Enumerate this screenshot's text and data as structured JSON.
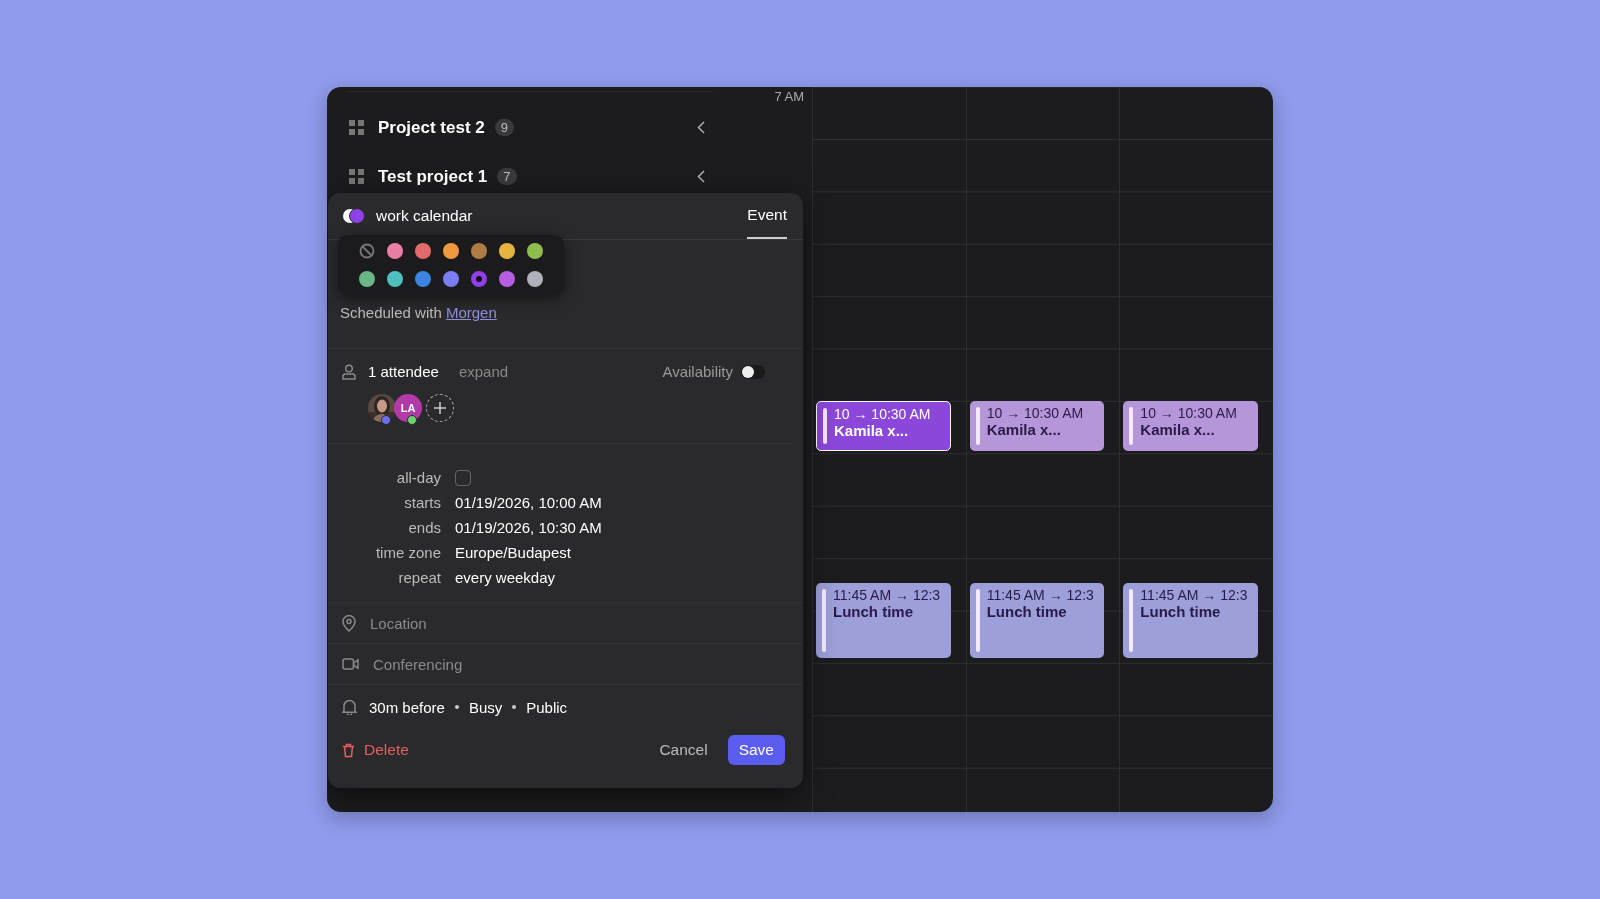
{
  "sidebar": {
    "projects": [
      {
        "name": "Project test 2",
        "count": "9"
      },
      {
        "name": "Test project 1",
        "count": "7"
      }
    ]
  },
  "calendar": {
    "hour_labels": [
      "7 AM"
    ],
    "days": [
      {
        "events": [
          {
            "kind": "meeting",
            "time": "10 → 10:30 AM",
            "title": "Kamila x...",
            "selected": true
          },
          {
            "kind": "lunch",
            "time": "11:45 AM → 12:3",
            "title": "Lunch time",
            "selected": false
          }
        ]
      },
      {
        "events": [
          {
            "kind": "meeting",
            "time": "10 → 10:30 AM",
            "title": "Kamila x...",
            "selected": false
          },
          {
            "kind": "lunch",
            "time": "11:45 AM → 12:3",
            "title": "Lunch time",
            "selected": false
          }
        ]
      },
      {
        "events": [
          {
            "kind": "meeting",
            "time": "10 → 10:30 AM",
            "title": "Kamila x...",
            "selected": false
          },
          {
            "kind": "lunch",
            "time": "11:45 AM → 12:3",
            "title": "Lunch time",
            "selected": false
          }
        ]
      }
    ]
  },
  "event_popup": {
    "calendar_name": "work calendar",
    "tabs": [
      {
        "label": "Event",
        "selected": true
      }
    ],
    "color_picker": {
      "swatches": [
        {
          "kind": "none",
          "selected": false
        },
        {
          "kind": "color",
          "color": "#e97fa6",
          "selected": false
        },
        {
          "kind": "color",
          "color": "#e26a6a",
          "selected": false
        },
        {
          "kind": "color",
          "color": "#ef9a3e",
          "selected": false
        },
        {
          "kind": "color",
          "color": "#b07a45",
          "selected": false
        },
        {
          "kind": "color",
          "color": "#e6b53f",
          "selected": false
        },
        {
          "kind": "color",
          "color": "#8fbc4e",
          "selected": false
        },
        {
          "kind": "color",
          "color": "#6cb587",
          "selected": false
        },
        {
          "kind": "color",
          "color": "#4fc0c0",
          "selected": false
        },
        {
          "kind": "color",
          "color": "#3d84e0",
          "selected": false
        },
        {
          "kind": "color",
          "color": "#7b7ef0",
          "selected": false
        },
        {
          "kind": "color",
          "color": "#9040e8",
          "selected": true
        },
        {
          "kind": "color",
          "color": "#b45fe0",
          "selected": false
        },
        {
          "kind": "color",
          "color": "#b0b0b8",
          "selected": false
        }
      ]
    },
    "scheduled_with": {
      "text": "Scheduled with",
      "link": "Morgen"
    },
    "attendees": {
      "count_label": "1 attendee",
      "expand": "expand",
      "availability_label": "Availability",
      "availability_on": false,
      "people": [
        {
          "kind": "picture",
          "color": "#6d6df0"
        },
        {
          "kind": "initials",
          "initials": "LA",
          "color": "#6cd36c"
        }
      ]
    },
    "details": [
      {
        "kind": "checkbox",
        "label": "all-day",
        "checked": false
      },
      {
        "kind": "text",
        "label": "starts",
        "value": "01/19/2026, 10:00 AM"
      },
      {
        "kind": "text",
        "label": "ends",
        "value": "01/19/2026, 10:30 AM"
      },
      {
        "kind": "text",
        "label": "time zone",
        "value": "Europe/Budapest"
      },
      {
        "kind": "text",
        "label": "repeat",
        "value": "every weekday"
      }
    ],
    "location": {
      "placeholder": "Location"
    },
    "conferencing": {
      "placeholder": "Conferencing"
    },
    "notification": [
      "30m before",
      "Busy",
      "Public"
    ],
    "actions": {
      "delete": "Delete",
      "cancel": "Cancel",
      "save": "Save"
    }
  }
}
